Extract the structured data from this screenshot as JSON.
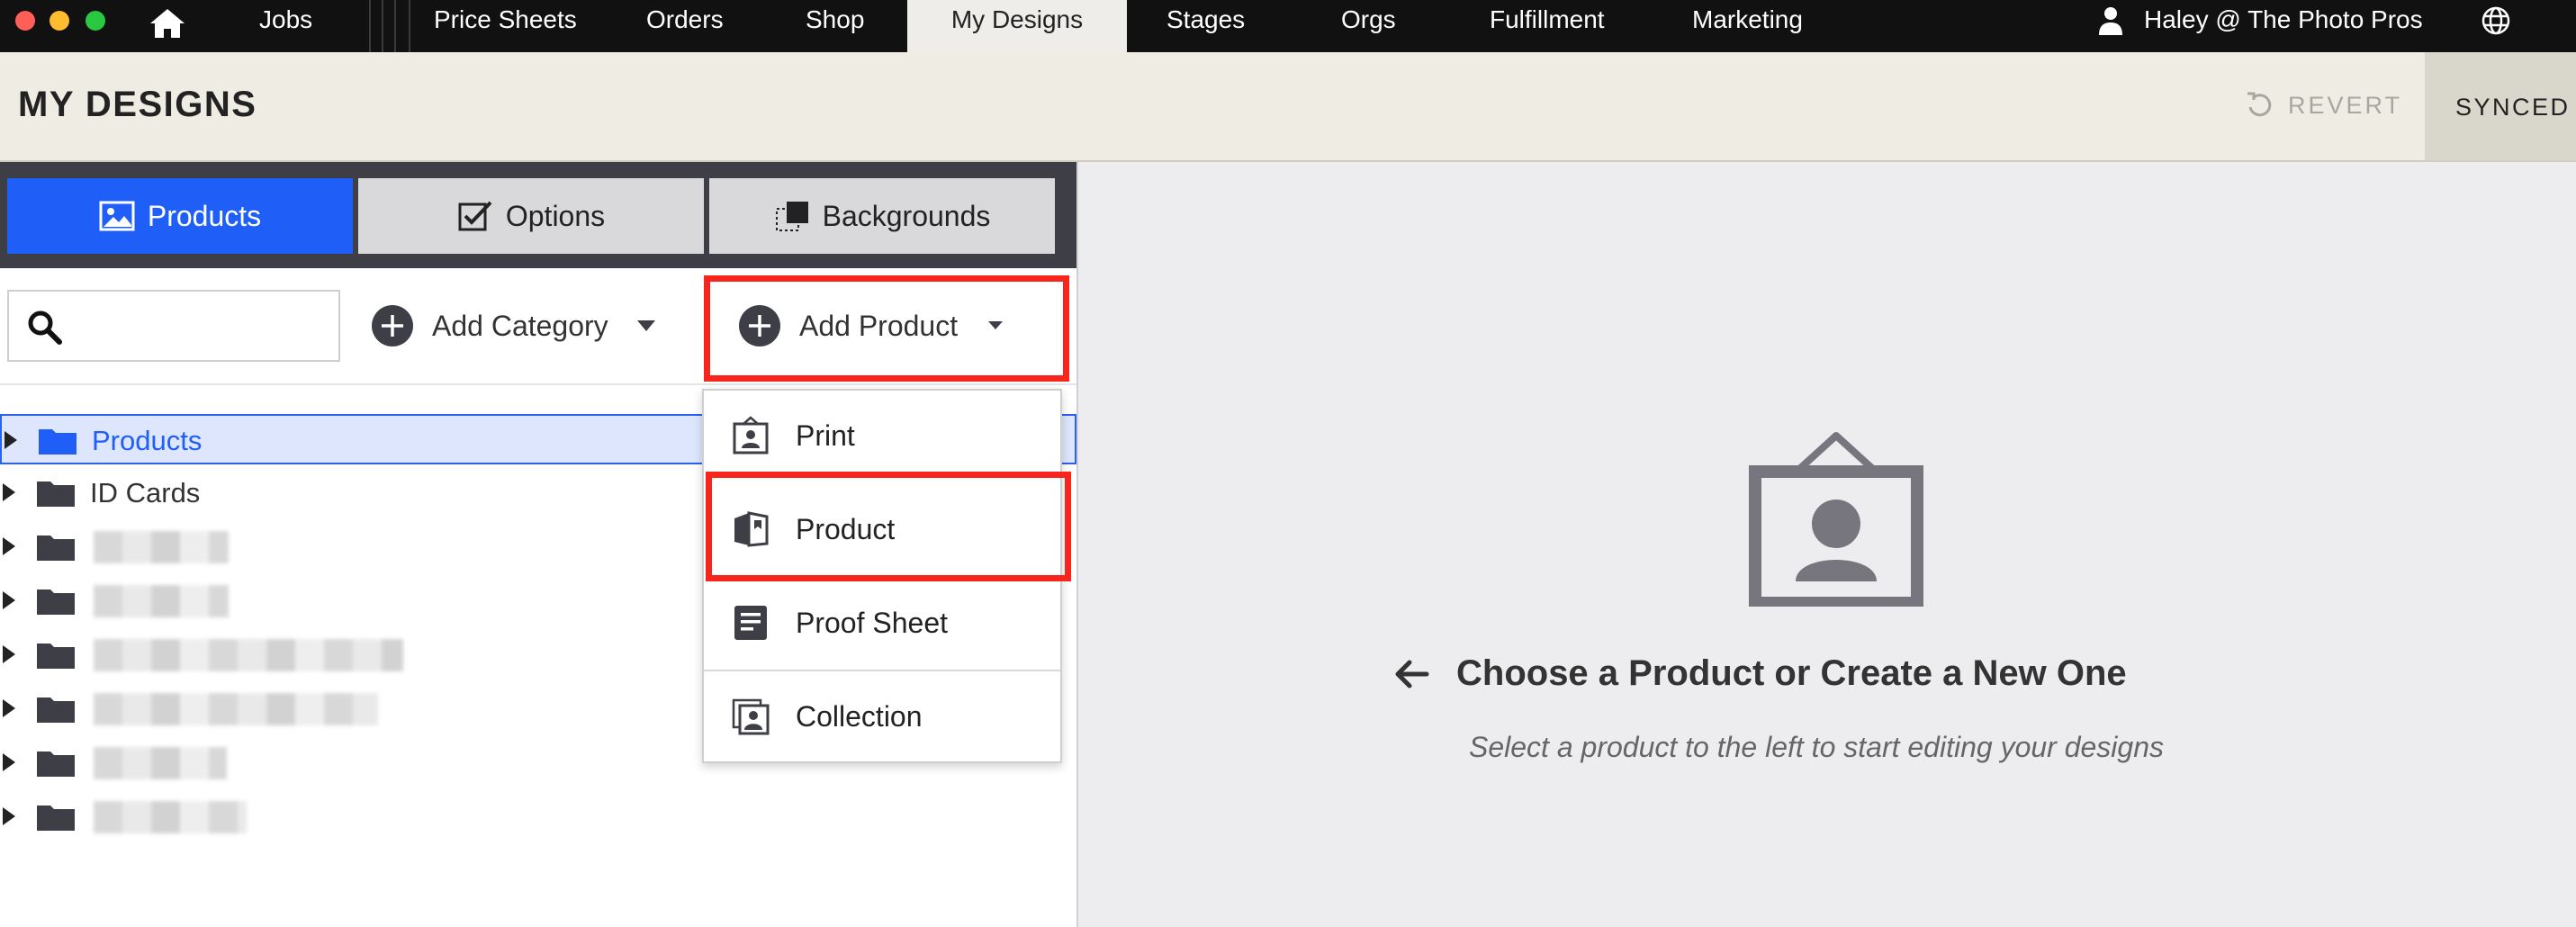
{
  "nav": {
    "items": [
      {
        "label": "Jobs"
      },
      {
        "label": "Price Sheets"
      },
      {
        "label": "Orders"
      },
      {
        "label": "Shop"
      },
      {
        "label": "My Designs",
        "active": true
      },
      {
        "label": "Stages"
      },
      {
        "label": "Orgs"
      },
      {
        "label": "Fulfillment"
      },
      {
        "label": "Marketing"
      }
    ],
    "user_label": "Haley @ The Photo Pros"
  },
  "header": {
    "title": "MY DESIGNS",
    "revert_label": "REVERT",
    "synced_label": "SYNCED"
  },
  "tabs": [
    {
      "label": "Products",
      "icon": "image-icon",
      "active": true
    },
    {
      "label": "Options",
      "icon": "checkbox-icon"
    },
    {
      "label": "Backgrounds",
      "icon": "backgrounds-icon"
    }
  ],
  "toolbar": {
    "search_value": "",
    "add_category_label": "Add Category",
    "add_product_label": "Add Product"
  },
  "tree": {
    "items": [
      {
        "label": "Products",
        "selected": true
      },
      {
        "label": "ID Cards"
      }
    ]
  },
  "dropdown": {
    "items": [
      {
        "label": "Print",
        "icon": "print-portrait-icon"
      },
      {
        "label": "Product",
        "icon": "product-box-icon",
        "highlighted": true
      },
      {
        "label": "Proof Sheet",
        "icon": "proof-sheet-icon"
      },
      {
        "label": "Collection",
        "icon": "collection-icon"
      }
    ]
  },
  "empty_state": {
    "title": "Choose a Product or Create a New One",
    "subtitle": "Select a product to the left to start editing your designs"
  },
  "colors": {
    "accent_blue": "#1f5ff8",
    "highlight_red": "#f7251c",
    "topbar": "#111111",
    "header_bg": "#efede3"
  }
}
